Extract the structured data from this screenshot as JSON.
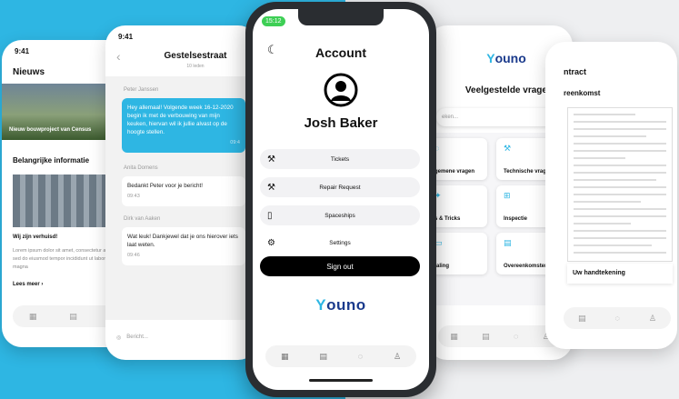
{
  "colors": {
    "accent": "#2eb6e3",
    "brand_dark": "#1a3a8c",
    "background_left": "#2eb6e3",
    "background_right": "#eeeff1"
  },
  "phone_news": {
    "status_time": "9:41",
    "title": "Nieuws",
    "featured_caption": "Nieuw bouwproject van Census",
    "section_title": "Belangrijke informatie",
    "article_title": "Wij zijn verhuisd!",
    "article_body": "Lorem ipsum dolor sit amet, consectetur adipiscing elit, sed do eiusmod tempor incididunt ut labore et dolore magna",
    "read_more": "Lees meer"
  },
  "phone_chat": {
    "status_time": "9:41",
    "title": "Gestelsestraat",
    "subtitle": "10 leden",
    "messages": [
      {
        "sender": "Peter Janssen",
        "text": "Hey allemaal! Volgende week 16-12-2020 begin ik met de verbouwing van mijn keuken, hiervan wil ik jullie alvast op de hoogte stellen.",
        "time": "09:4"
      },
      {
        "sender": "Anita Domens",
        "text": "Bedankt Peter voor je bericht!",
        "time": "09:43"
      },
      {
        "sender": "Dirk van Aaken",
        "text": "Wat leuk! Dankjewel dat je ons hierover iets laat weten.",
        "time": "09:46"
      }
    ],
    "input_placeholder": "Bericht..."
  },
  "phone_account": {
    "status_time": "15:12",
    "title": "Account",
    "user_name": "Josh Baker",
    "menu": [
      {
        "label": "Tickets",
        "icon": "hammer-icon"
      },
      {
        "label": "Repair Request",
        "icon": "hammer-icon"
      },
      {
        "label": "Spaceships",
        "icon": "document-icon"
      },
      {
        "label": "Settings",
        "icon": "gear-icon"
      }
    ],
    "sign_out": "Sign out",
    "logo_a": "Y",
    "logo_b": "ouno"
  },
  "phone_faq": {
    "logo_a": "Y",
    "logo_b": "ouno",
    "title": "Veelgestelde vragen",
    "search_placeholder": "eken...",
    "categories": [
      "gemene vragen",
      "Technische vragen",
      "s & Tricks",
      "Inspectie",
      "taling",
      "Overeenkomsten"
    ]
  },
  "phone_contract": {
    "title": "ntract",
    "subtitle": "reenkomst",
    "signature_label": "Uw handtekening"
  }
}
